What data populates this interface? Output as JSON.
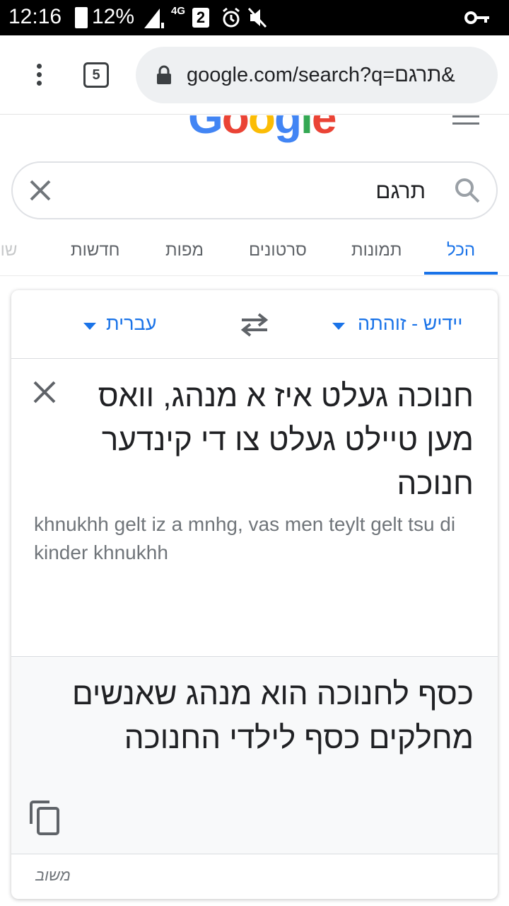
{
  "status_bar": {
    "time": "12:16",
    "battery": "12%",
    "network": "4G",
    "sim": "2"
  },
  "browser": {
    "tab_count": "5",
    "url": "google.com/search?q=תרגם&"
  },
  "logo": [
    "G",
    "o",
    "o",
    "g",
    "l",
    "e"
  ],
  "logo_colors": [
    "#4285f4",
    "#ea4335",
    "#fbbc05",
    "#4285f4",
    "#34a853",
    "#ea4335"
  ],
  "search": {
    "query": "תרגם"
  },
  "nav_tabs": [
    {
      "label": "הכל",
      "active": true
    },
    {
      "label": "תמונות",
      "active": false
    },
    {
      "label": "סרטונים",
      "active": false
    },
    {
      "label": "מפות",
      "active": false
    },
    {
      "label": "חדשות",
      "active": false
    },
    {
      "label": "שופ",
      "active": false
    }
  ],
  "translate": {
    "source_lang": "יידיש - זוהתה",
    "target_lang": "עברית",
    "source_text": "חנוכה געלט איז א מנהג, וואס מען טיילט געלט צו די קינדער חנוכה",
    "transliteration": "khnukhh gelt iz a mnhg, vas men teylt gelt tsu di kinder khnukhh",
    "translated_text": "כסף לחנוכה הוא מנהג שאנשים מחלקים כסף לילדי החנוכה",
    "feedback_label": "משוב"
  },
  "colors": {
    "accent": "#1a73e8",
    "text": "#202124",
    "muted": "#70757a",
    "target_bg": "#f8f9fa"
  },
  "icons": {
    "menu": "more-vert-icon",
    "lock": "lock-icon",
    "clear": "close-icon",
    "search": "search-icon",
    "swap": "swap-icon",
    "copy": "copy-icon"
  }
}
